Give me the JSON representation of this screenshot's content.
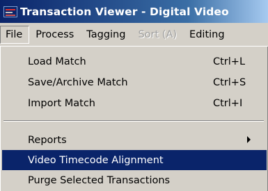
{
  "window": {
    "title": "Transaction Viewer - Digital Video",
    "icon": "app-icon"
  },
  "menubar": {
    "items": [
      {
        "label": "File",
        "state": "open"
      },
      {
        "label": "Process",
        "state": "normal"
      },
      {
        "label": "Tagging",
        "state": "normal"
      },
      {
        "label": "Sort (A)",
        "state": "disabled"
      },
      {
        "label": "Editing",
        "state": "normal"
      }
    ]
  },
  "file_menu": {
    "items": [
      {
        "label": "Load Match",
        "shortcut": "Ctrl+L"
      },
      {
        "label": "Save/Archive Match",
        "shortcut": "Ctrl+S"
      },
      {
        "label": "Import Match",
        "shortcut": "Ctrl+I"
      },
      {
        "label": "Reports",
        "submenu_icon": "chevron-right-icon"
      },
      {
        "label": "Video Timecode Alignment",
        "highlighted": true
      },
      {
        "label": "Purge Selected Transactions"
      }
    ]
  },
  "colors": {
    "highlight": "#0a246a",
    "menu_bg": "#d4d0c8",
    "disabled_text": "#a0a0a0"
  }
}
